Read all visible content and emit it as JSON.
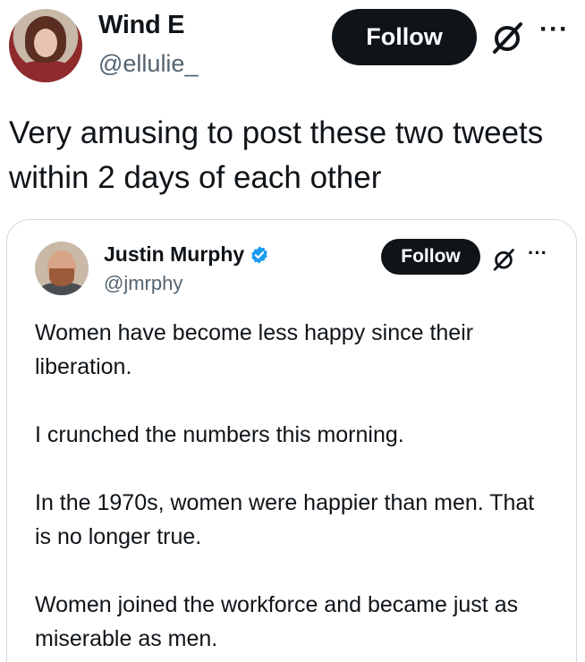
{
  "tweet": {
    "author": {
      "name": "Wind E",
      "handle": "@ellulie_"
    },
    "follow_label": "Follow",
    "more_label": "···",
    "text": "Very amusing to post these two tweets within 2 days of each other"
  },
  "quote": {
    "author": {
      "name": "Justin Murphy",
      "handle": "@jmrphy",
      "verified": true
    },
    "follow_label": "Follow",
    "more_label": "···",
    "paragraphs": [
      "Women have become less happy since their liberation.",
      "I crunched the numbers this morning.",
      "In the 1970s, women were happier than men. That is no longer true.",
      "Women joined the workforce and became just as miserable as men."
    ]
  },
  "colors": {
    "text": "#0f1419",
    "muted": "#536471",
    "button_bg": "#0f1419",
    "button_text": "#ffffff",
    "border": "#cfd9de",
    "verified": "#1d9bf0"
  },
  "icons": [
    "grok-slash-icon",
    "more-icon",
    "verified-badge-icon"
  ]
}
